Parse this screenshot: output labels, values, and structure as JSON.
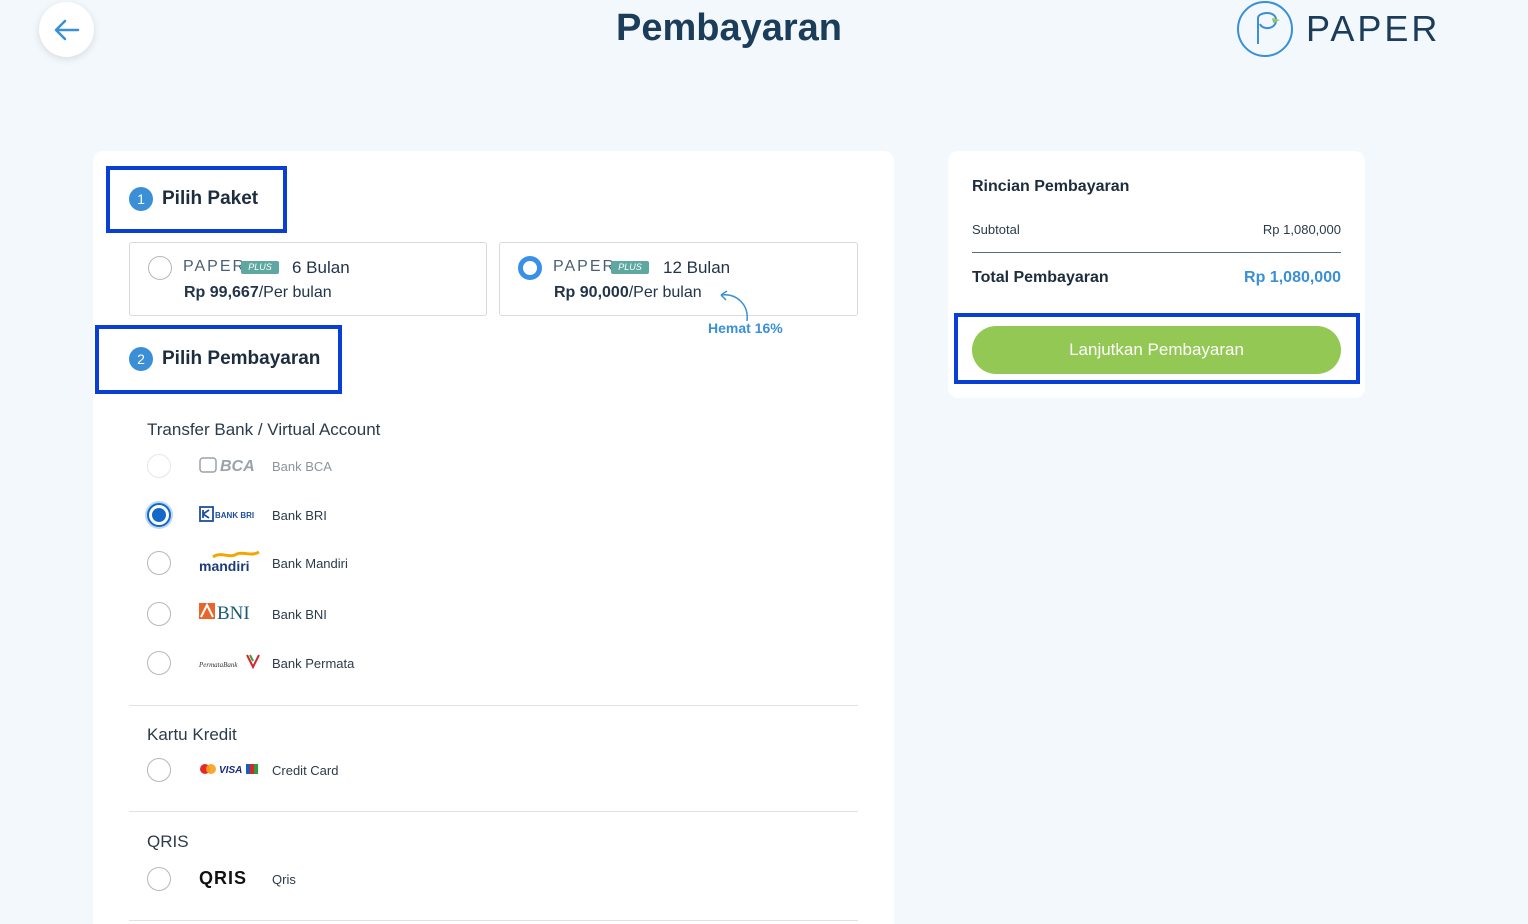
{
  "header": {
    "title": "Pembayaran",
    "logo_text": "PAPER"
  },
  "steps": {
    "step1": {
      "number": "1",
      "label": "Pilih Paket"
    },
    "step2": {
      "number": "2",
      "label": "Pilih Pembayaran"
    }
  },
  "plans": [
    {
      "brand": "PAPER",
      "badge": "PLUS",
      "duration": "6 Bulan",
      "price": "Rp 99,667",
      "period": "/Per bulan",
      "selected": false
    },
    {
      "brand": "PAPER",
      "badge": "PLUS",
      "duration": "12 Bulan",
      "price": "Rp 90,000",
      "period": "/Per bulan",
      "selected": true
    }
  ],
  "savings_note": "Hemat 16%",
  "payment_groups": {
    "bank": {
      "title": "Transfer Bank / Virtual Account",
      "items": [
        {
          "logo": "BCA",
          "label": "Bank BCA",
          "state": "disabled"
        },
        {
          "logo": "BANK BRI",
          "label": "Bank BRI",
          "state": "selected"
        },
        {
          "logo": "mandiri",
          "label": "Bank Mandiri",
          "state": "unselected"
        },
        {
          "logo": "BNI",
          "label": "Bank BNI",
          "state": "unselected"
        },
        {
          "logo": "PermataBank",
          "label": "Bank Permata",
          "state": "unselected"
        }
      ]
    },
    "card": {
      "title": "Kartu Kredit",
      "items": [
        {
          "logo": "VISA",
          "label": "Credit Card",
          "state": "unselected"
        }
      ]
    },
    "qris": {
      "title": "QRIS",
      "items": [
        {
          "logo": "QRIS",
          "label": "Qris",
          "state": "unselected"
        }
      ]
    }
  },
  "summary": {
    "title": "Rincian Pembayaran",
    "subtotal_label": "Subtotal",
    "subtotal_value": "Rp 1,080,000",
    "total_label": "Total Pembayaran",
    "total_value": "Rp 1,080,000",
    "continue_label": "Lanjutkan Pembayaran"
  },
  "colors": {
    "accent_blue": "#3a8fd6",
    "button_green": "#92c853",
    "highlight_box": "#0a3fd6",
    "title_navy": "#1b3d5a"
  }
}
